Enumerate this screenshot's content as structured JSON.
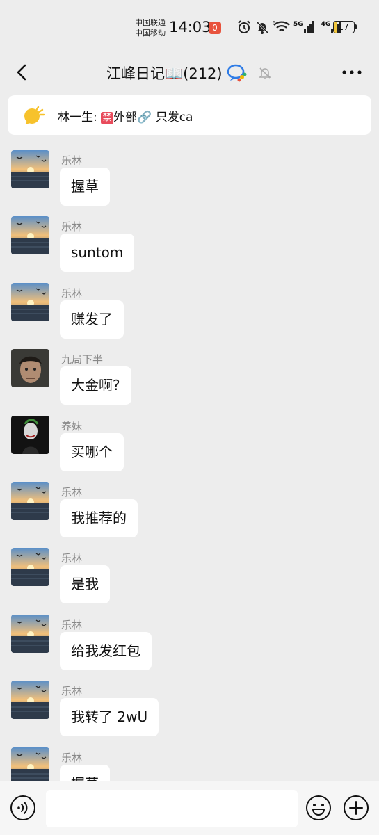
{
  "status_bar": {
    "carrier_1": "中国联通",
    "carrier_2": "中国移动",
    "time": "14:03",
    "notification_badge": "0",
    "network_1": "5G",
    "network_2": "4G",
    "battery": "17",
    "battery_level": 0.17,
    "icons": [
      "alarm-icon",
      "mute-icon",
      "wifi-icon",
      "signal-5g-icon",
      "signal-4g-icon",
      "battery-icon"
    ]
  },
  "header": {
    "title": "江峰日记📖(212)",
    "icons": [
      "back-icon",
      "group-badge-icon",
      "mute-bell-icon",
      "more-icon"
    ]
  },
  "pinned": {
    "sender": "林一生:",
    "ban": "禁",
    "text": "外部🔗 只发ca"
  },
  "messages": [
    {
      "sender": "乐林",
      "text": "握草",
      "avatar": "sunset"
    },
    {
      "sender": "乐林",
      "text": "suntom",
      "avatar": "sunset"
    },
    {
      "sender": "乐林",
      "text": "赚发了",
      "avatar": "sunset"
    },
    {
      "sender": "九局下半",
      "text": "大金啊?",
      "avatar": "face"
    },
    {
      "sender": "养妹",
      "text": "买哪个",
      "avatar": "dark"
    },
    {
      "sender": "乐林",
      "text": "我推荐的",
      "avatar": "sunset"
    },
    {
      "sender": "乐林",
      "text": "是我",
      "avatar": "sunset"
    },
    {
      "sender": "乐林",
      "text": "给我发红包",
      "avatar": "sunset"
    },
    {
      "sender": "乐林",
      "text": "我转了 2wU",
      "avatar": "sunset"
    },
    {
      "sender": "乐林",
      "text": "握草",
      "avatar": "sunset"
    }
  ],
  "input_bar": {
    "placeholder": "",
    "icons": [
      "voice-icon",
      "emoji-icon",
      "plus-icon"
    ]
  },
  "colors": {
    "background": "#ededed",
    "bubble": "#ffffff",
    "sender": "#888888",
    "ban_badge": "#e84b5b",
    "battery_fill": "#f2c73d"
  }
}
